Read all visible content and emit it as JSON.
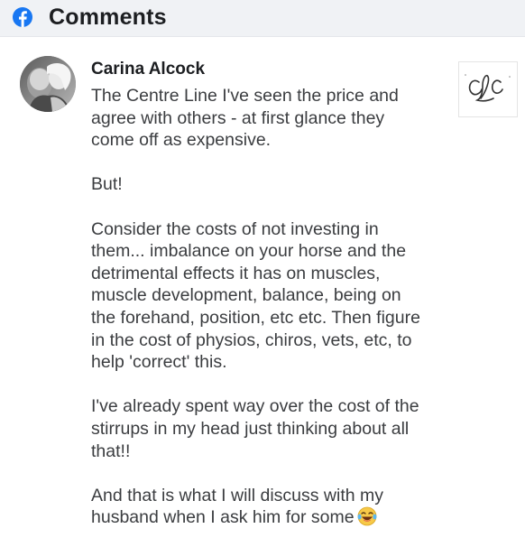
{
  "header": {
    "title": "Comments",
    "icon": "facebook-icon",
    "brand_color": "#1877f2"
  },
  "comment": {
    "author": "Carina Alcock",
    "avatar_icon": "profile-photo",
    "logo_text": "CLC",
    "paragraphs": [
      "The Centre Line I've seen the price and\nagree with others - at first glance they\ncome off as expensive.",
      "But!",
      "Consider the costs of not investing in\nthem... imbalance on your horse and the\ndetrimental effects it has on muscles,\nmuscle development, balance, being on\nthe forehand, position, etc etc. Then figure\nin the cost of physios, chiros, vets, etc, to\nhelp 'correct' this.",
      "I've already spent way over the cost of the\nstirrups in my head just thinking about all\nthat!!",
      "And that is what I will discuss with my\nhusband when I ask him for some"
    ],
    "trailing_emoji": "laughing-tears-emoji"
  }
}
